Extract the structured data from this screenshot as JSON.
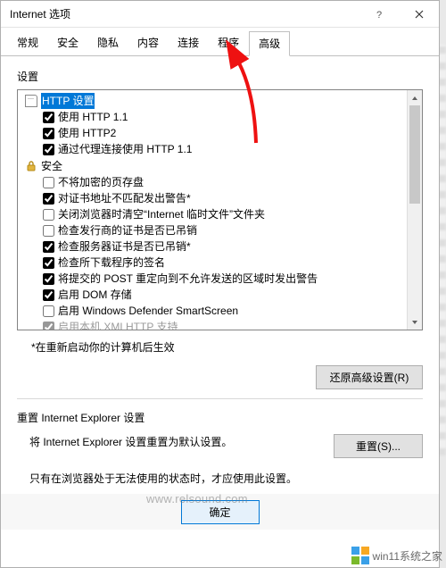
{
  "window": {
    "title": "Internet 选项"
  },
  "tabs": [
    "常规",
    "安全",
    "隐私",
    "内容",
    "连接",
    "程序",
    "高级"
  ],
  "active_tab_index": 6,
  "settings_group_label": "设置",
  "tree": {
    "cat_http": "HTTP 设置",
    "http": [
      {
        "checked": true,
        "label": "使用 HTTP 1.1"
      },
      {
        "checked": true,
        "label": "使用 HTTP2"
      },
      {
        "checked": true,
        "label": "通过代理连接使用 HTTP 1.1"
      }
    ],
    "cat_security": "安全",
    "security": [
      {
        "checked": false,
        "label": "不将加密的页存盘"
      },
      {
        "checked": true,
        "label": "对证书地址不匹配发出警告*"
      },
      {
        "checked": false,
        "label": "关闭浏览器时清空“Internet 临时文件”文件夹"
      },
      {
        "checked": false,
        "label": "检查发行商的证书是否已吊销"
      },
      {
        "checked": true,
        "label": "检查服务器证书是否已吊销*"
      },
      {
        "checked": true,
        "label": "检查所下载程序的签名"
      },
      {
        "checked": true,
        "label": "将提交的 POST 重定向到不允许发送的区域时发出警告"
      },
      {
        "checked": true,
        "label": "启用 DOM 存储"
      },
      {
        "checked": false,
        "label": "启用 Windows Defender SmartScreen"
      },
      {
        "checked": true,
        "label": "启用本机 XMLHTTP 支持"
      }
    ]
  },
  "footnote_text": "*在重新启动你的计算机后生效",
  "restore_button": "还原高级设置(R)",
  "reset_section_label": "重置 Internet Explorer 设置",
  "reset_desc": "将 Internet Explorer 设置重置为默认设置。",
  "reset_button": "重置(S)...",
  "reset_note": "只有在浏览器处于无法使用的状态时，才应使用此设置。",
  "ok_button": "确定",
  "watermark": {
    "brand": "win11系统之家",
    "url": "www.relsound.com"
  }
}
